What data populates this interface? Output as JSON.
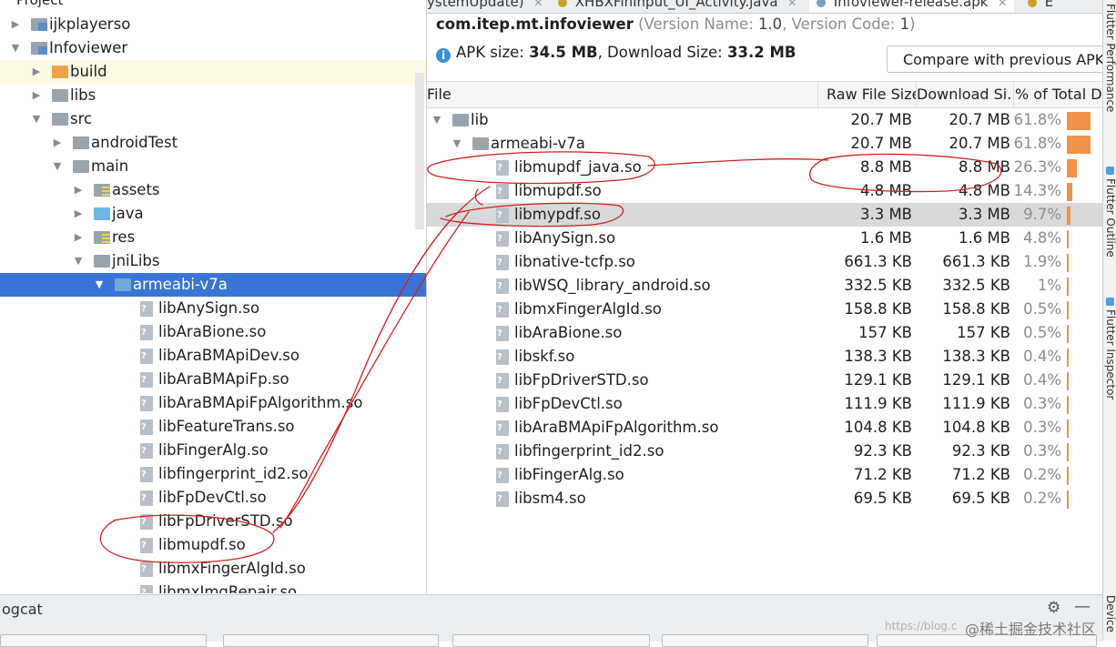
{
  "left_panel": {
    "header": "Project",
    "tree": [
      {
        "label": "ijkplayerso",
        "arrow": "▶",
        "icon": "module"
      },
      {
        "label": "Infoviewer",
        "arrow": "▼",
        "icon": "module"
      },
      {
        "label": "build",
        "arrow": "▶",
        "icon": "folder-orange"
      },
      {
        "label": "libs",
        "arrow": "▶",
        "icon": "folder"
      },
      {
        "label": "src",
        "arrow": "▼",
        "icon": "folder"
      },
      {
        "label": "androidTest",
        "arrow": "▶",
        "icon": "folder"
      },
      {
        "label": "main",
        "arrow": "▼",
        "icon": "folder"
      },
      {
        "label": "assets",
        "arrow": "▶",
        "icon": "folder-assets"
      },
      {
        "label": "java",
        "arrow": "▶",
        "icon": "folder-blue"
      },
      {
        "label": "res",
        "arrow": "▶",
        "icon": "folder-res"
      },
      {
        "label": "jniLibs",
        "arrow": "▼",
        "icon": "folder"
      },
      {
        "label": "armeabi-v7a",
        "arrow": "▼",
        "icon": "folder-open",
        "selected": true
      },
      {
        "label": "libAnySign.so",
        "icon": "so-file"
      },
      {
        "label": "libAraBione.so",
        "icon": "so-file"
      },
      {
        "label": "libAraBMApiDev.so",
        "icon": "so-file"
      },
      {
        "label": "libAraBMApiFp.so",
        "icon": "so-file"
      },
      {
        "label": "libAraBMApiFpAlgorithm.so",
        "icon": "so-file"
      },
      {
        "label": "libFeatureTrans.so",
        "icon": "so-file"
      },
      {
        "label": "libFingerAlg.so",
        "icon": "so-file"
      },
      {
        "label": "libfingerprint_id2.so",
        "icon": "so-file"
      },
      {
        "label": "libFpDevCtl.so",
        "icon": "so-file"
      },
      {
        "label": "libFpDriverSTD.so",
        "icon": "so-file"
      },
      {
        "label": "libmupdf.so",
        "icon": "so-file"
      },
      {
        "label": "libmxFingerAlgId.so",
        "icon": "so-file"
      },
      {
        "label": "libmxImgRepair.so",
        "icon": "so-file"
      }
    ]
  },
  "tabs": [
    {
      "label": "ystemUpdate)"
    },
    {
      "label": "XHBXFinInput_UI_Activity.java"
    },
    {
      "label": "Infoviewer-release.apk",
      "active": true
    },
    {
      "label": "E"
    }
  ],
  "apk": {
    "package_name": "com.itep.mt.infoviewer",
    "version_open": "(Version Name: ",
    "version_name": "1.0",
    "version_code_label": ", Version Code: ",
    "version_code": "1",
    "version_close": ")",
    "apk_size_label": "APK size: ",
    "apk_size": "34.5 MB",
    "download_size_label": ", Download Size: ",
    "download_size": "33.2 MB",
    "compare_button": "Compare with previous APK..."
  },
  "table": {
    "columns": [
      "File",
      "Raw File Size",
      "Download Si...",
      "% of Total D"
    ],
    "rows": [
      {
        "name": "lib",
        "raw": "20.7 MB",
        "download": "20.7 MB",
        "percent": "61.8%",
        "share": 0.618,
        "arrow": "▼",
        "icon": "folder"
      },
      {
        "name": "armeabi-v7a",
        "raw": "20.7 MB",
        "download": "20.7 MB",
        "percent": "61.8%",
        "share": 0.618,
        "arrow": "▼",
        "icon": "folder"
      },
      {
        "name": "libmupdf_java.so",
        "raw": "8.8 MB",
        "download": "8.8 MB",
        "percent": "26.3%",
        "share": 0.263,
        "icon": "so-file"
      },
      {
        "name": "libmupdf.so",
        "raw": "4.8 MB",
        "download": "4.8 MB",
        "percent": "14.3%",
        "share": 0.143,
        "icon": "so-file"
      },
      {
        "name": "libmypdf.so",
        "raw": "3.3 MB",
        "download": "3.3 MB",
        "percent": "9.7%",
        "share": 0.097,
        "icon": "so-file",
        "highlighted": true
      },
      {
        "name": "libAnySign.so",
        "raw": "1.6 MB",
        "download": "1.6 MB",
        "percent": "4.8%",
        "share": 0.048,
        "icon": "so-file"
      },
      {
        "name": "libnative-tcfp.so",
        "raw": "661.3 KB",
        "download": "661.3 KB",
        "percent": "1.9%",
        "share": 0.019,
        "icon": "so-file"
      },
      {
        "name": "libWSQ_library_android.so",
        "raw": "332.5 KB",
        "download": "332.5 KB",
        "percent": "1%",
        "share": 0.01,
        "icon": "so-file"
      },
      {
        "name": "libmxFingerAlgId.so",
        "raw": "158.8 KB",
        "download": "158.8 KB",
        "percent": "0.5%",
        "share": 0.005,
        "icon": "so-file"
      },
      {
        "name": "libAraBione.so",
        "raw": "157 KB",
        "download": "157 KB",
        "percent": "0.5%",
        "share": 0.005,
        "icon": "so-file"
      },
      {
        "name": "libskf.so",
        "raw": "138.3 KB",
        "download": "138.3 KB",
        "percent": "0.4%",
        "share": 0.004,
        "icon": "so-file"
      },
      {
        "name": "libFpDriverSTD.so",
        "raw": "129.1 KB",
        "download": "129.1 KB",
        "percent": "0.4%",
        "share": 0.004,
        "icon": "so-file"
      },
      {
        "name": "libFpDevCtl.so",
        "raw": "111.9 KB",
        "download": "111.9 KB",
        "percent": "0.3%",
        "share": 0.003,
        "icon": "so-file"
      },
      {
        "name": "libAraBMApiFpAlgorithm.so",
        "raw": "104.8 KB",
        "download": "104.8 KB",
        "percent": "0.3%",
        "share": 0.003,
        "icon": "so-file"
      },
      {
        "name": "libfingerprint_id2.so",
        "raw": "92.3 KB",
        "download": "92.3 KB",
        "percent": "0.3%",
        "share": 0.003,
        "icon": "so-file"
      },
      {
        "name": "libFingerAlg.so",
        "raw": "71.2 KB",
        "download": "71.2 KB",
        "percent": "0.2%",
        "share": 0.002,
        "icon": "so-file"
      },
      {
        "name": "libsm4.so",
        "raw": "69.5 KB",
        "download": "69.5 KB",
        "percent": "0.2%",
        "share": 0.002,
        "icon": "so-file"
      }
    ]
  },
  "right_strip": [
    "Flutter Performance",
    "Flutter Outline",
    "Flutter Inspector",
    "Device"
  ],
  "bottom": {
    "logcat_label": "ogcat",
    "watermark": "@稀土掘金技术社区",
    "watermark_url": "https://blog.c"
  },
  "colors": {
    "selection": "#3875d7",
    "bar": "#f0924a",
    "annotation": "#d42020",
    "row_highlight": "#d9d9d9"
  }
}
